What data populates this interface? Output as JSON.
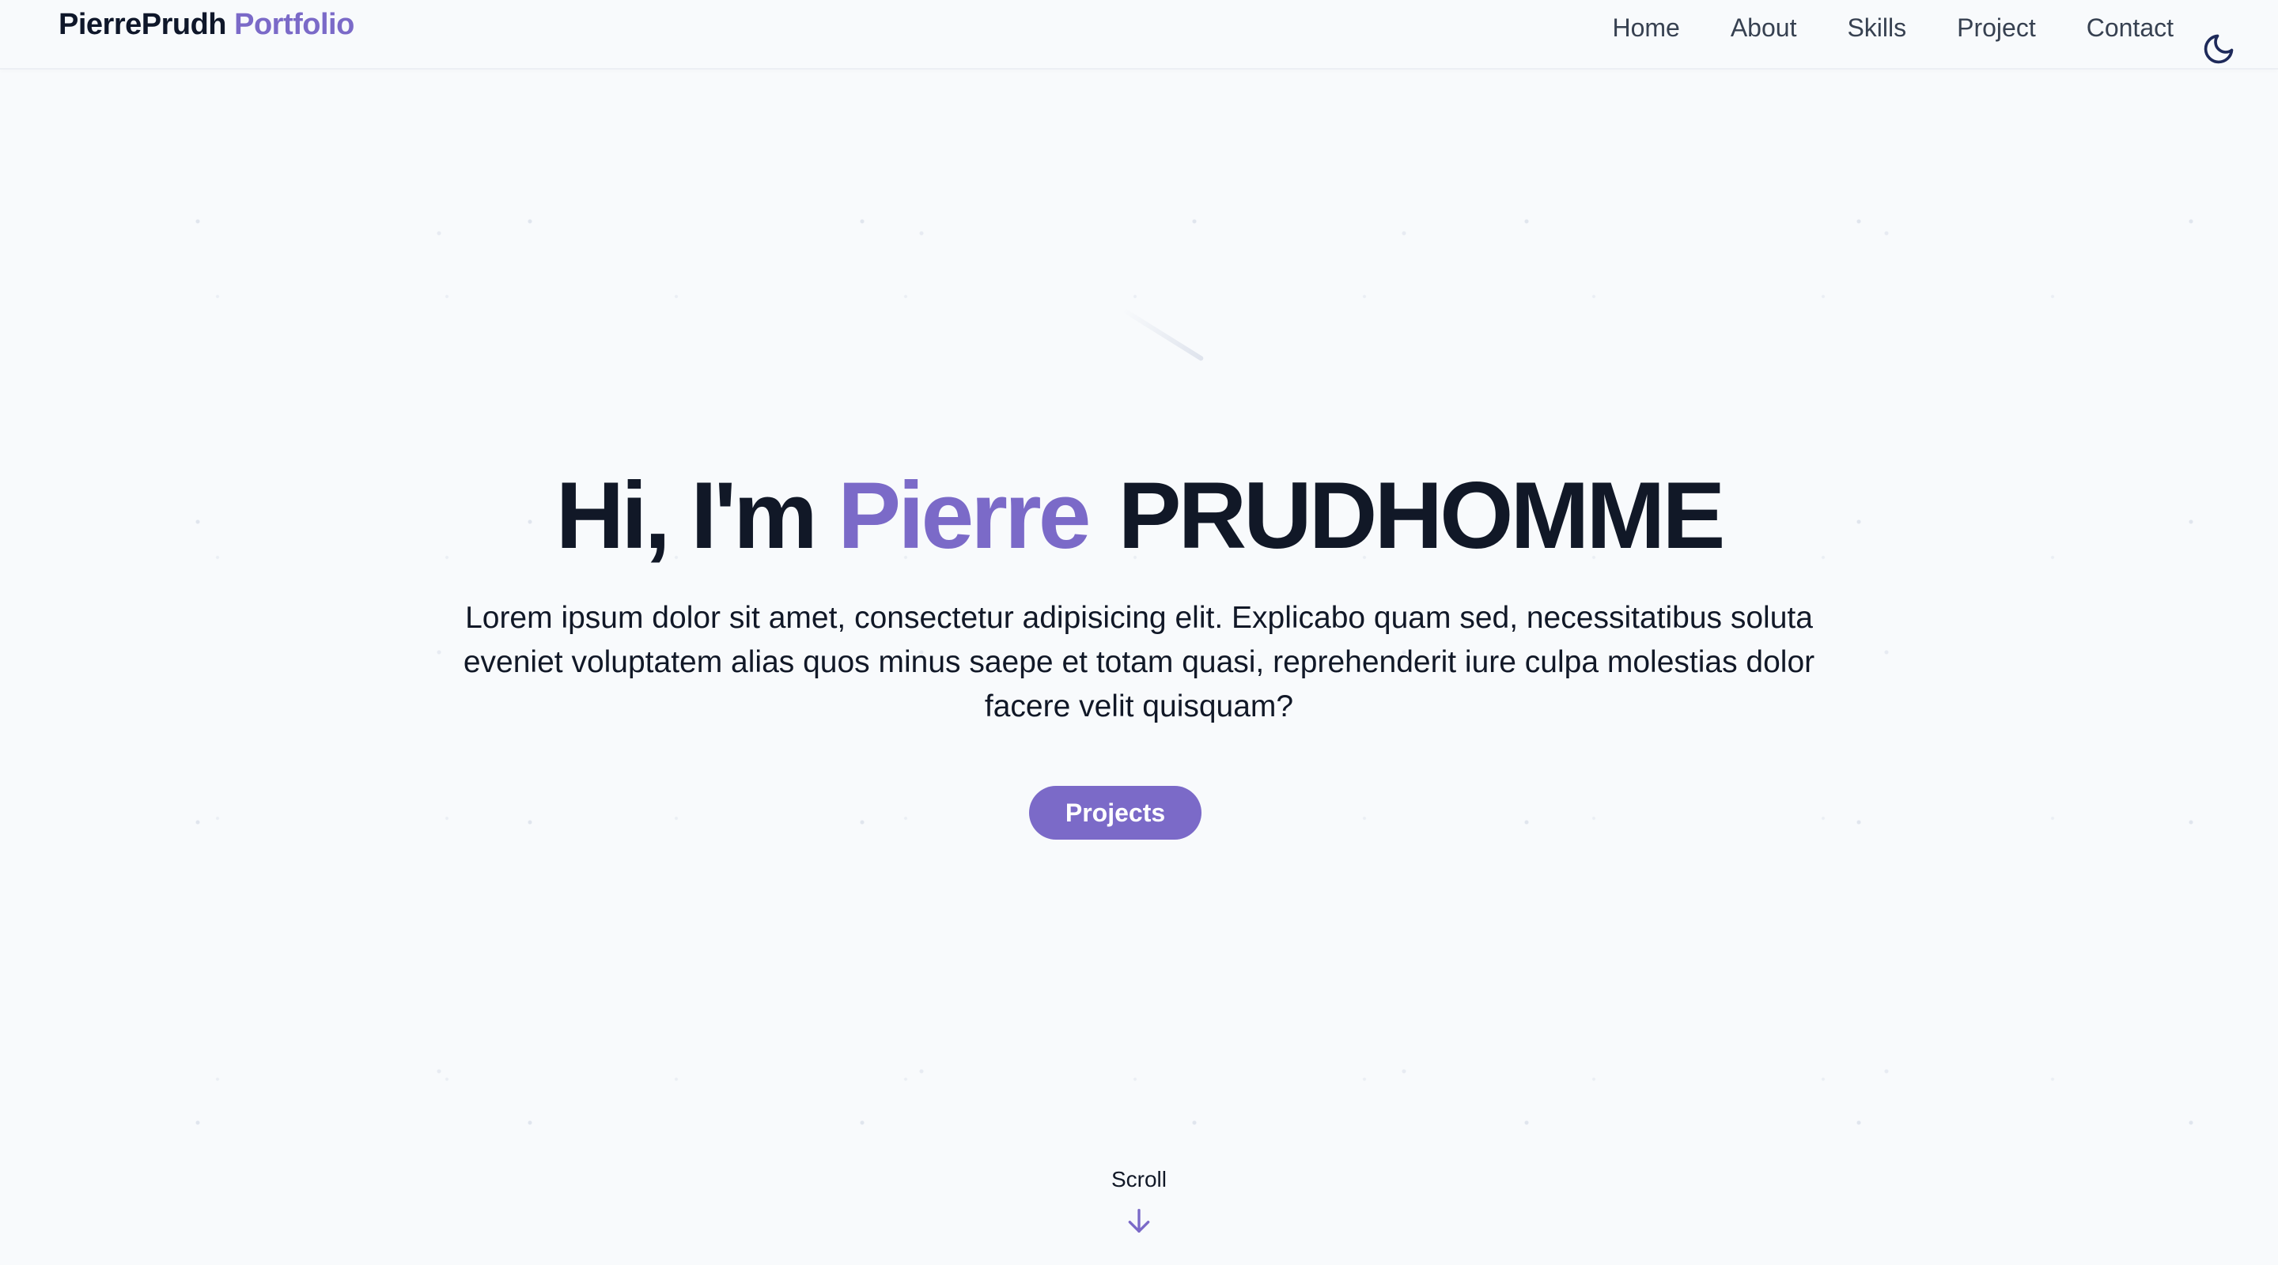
{
  "header": {
    "brand_name": "PierrePrudh",
    "brand_accent": "Portfolio",
    "nav": [
      {
        "label": "Home"
      },
      {
        "label": "About"
      },
      {
        "label": "Skills"
      },
      {
        "label": "Project"
      },
      {
        "label": "Contact"
      }
    ],
    "theme_icon": "moon-icon"
  },
  "hero": {
    "greeting": "Hi, I'm",
    "first_name": "Pierre",
    "last_name": "PRUDHOMME",
    "description": "Lorem ipsum dolor sit amet, consectetur adipisicing elit. Explicabo quam sed, necessitatibus soluta eveniet voluptatem alias quos minus saepe et totam quasi, reprehenderit iure culpa molestias dolor facere velit quisquam?",
    "cta_label": "Projects"
  },
  "scroll": {
    "label": "Scroll",
    "icon": "arrow-down-icon"
  },
  "colors": {
    "accent": "#7b6ac8",
    "text": "#111827",
    "background": "#f8fafc"
  }
}
